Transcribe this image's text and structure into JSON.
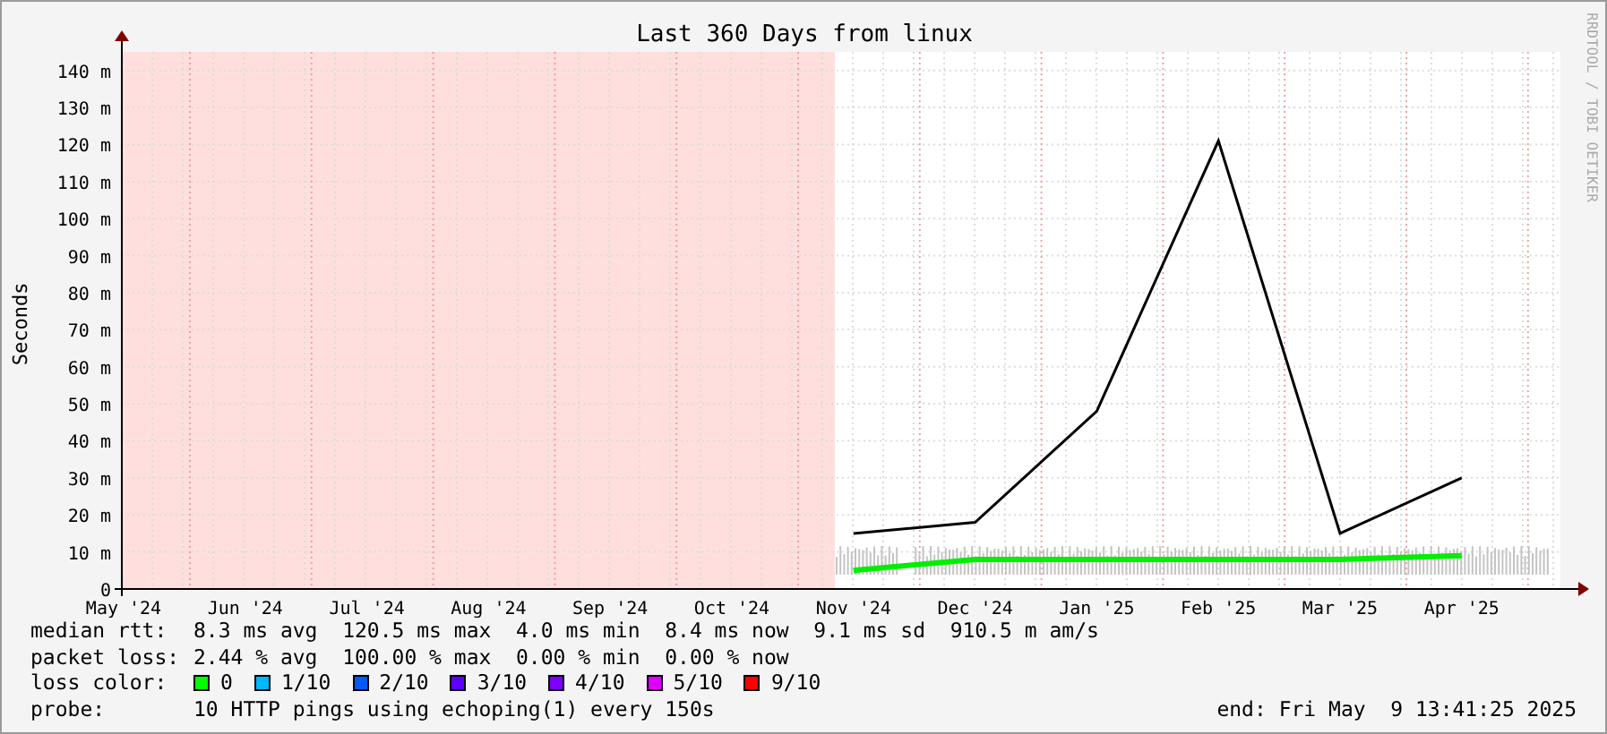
{
  "title": "Last 360 Days from linux",
  "side_label": "RRDTOOL / TOBI OETIKER",
  "chart_data": {
    "type": "line",
    "ylabel": "Seconds",
    "categories": [
      "May '24",
      "Jun '24",
      "Jul '24",
      "Aug '24",
      "Sep '24",
      "Oct '24",
      "Nov '24",
      "Dec '24",
      "Jan '25",
      "Feb '25",
      "Mar '25",
      "Apr '25"
    ],
    "series": [
      {
        "color": "#00ee00",
        "values": [
          null,
          null,
          null,
          null,
          null,
          null,
          5,
          8,
          8,
          8,
          8,
          9
        ]
      },
      {
        "color": "#000000",
        "values": [
          null,
          null,
          null,
          null,
          null,
          null,
          15,
          18,
          48,
          121,
          15,
          30
        ]
      }
    ],
    "grid": true,
    "ylim": [
      0,
      145
    ],
    "yticks": [
      {
        "value": 0,
        "label": "0"
      },
      {
        "value": 10,
        "label": "10 m"
      },
      {
        "value": 20,
        "label": "20 m"
      },
      {
        "value": 30,
        "label": "30 m"
      },
      {
        "value": 40,
        "label": "40 m"
      },
      {
        "value": 50,
        "label": "50 m"
      },
      {
        "value": 60,
        "label": "60 m"
      },
      {
        "value": 70,
        "label": "70 m"
      },
      {
        "value": 80,
        "label": "80 m"
      },
      {
        "value": 90,
        "label": "90 m"
      },
      {
        "value": 100,
        "label": "100 m"
      },
      {
        "value": 110,
        "label": "110 m"
      },
      {
        "value": 120,
        "label": "120 m"
      },
      {
        "value": 130,
        "label": "130 m"
      },
      {
        "value": 140,
        "label": "140 m"
      }
    ]
  },
  "legend": {
    "stats": [
      {
        "label": "median rtt:",
        "text": "8.3 ms avg  120.5 ms max  4.0 ms min  8.4 ms now  9.1 ms sd  910.5 m am/s"
      },
      {
        "label": "packet loss:",
        "text": "2.44 % avg  100.00 % max  0.00 % min  0.00 % now"
      }
    ],
    "loss_label": "loss color:",
    "loss_colors": [
      {
        "label": "0",
        "color": "#00ff00"
      },
      {
        "label": "1/10",
        "color": "#00b8ff"
      },
      {
        "label": "2/10",
        "color": "#0059ff"
      },
      {
        "label": "3/10",
        "color": "#5e00ff"
      },
      {
        "label": "4/10",
        "color": "#7e00ff"
      },
      {
        "label": "5/10",
        "color": "#dd00ff"
      },
      {
        "label": "9/10",
        "color": "#ff0000"
      }
    ],
    "probe_label": "probe:",
    "probe": "10 HTTP pings using echoping(1) every 150s",
    "end": "end: Fri May  9 13:41:25 2025"
  }
}
